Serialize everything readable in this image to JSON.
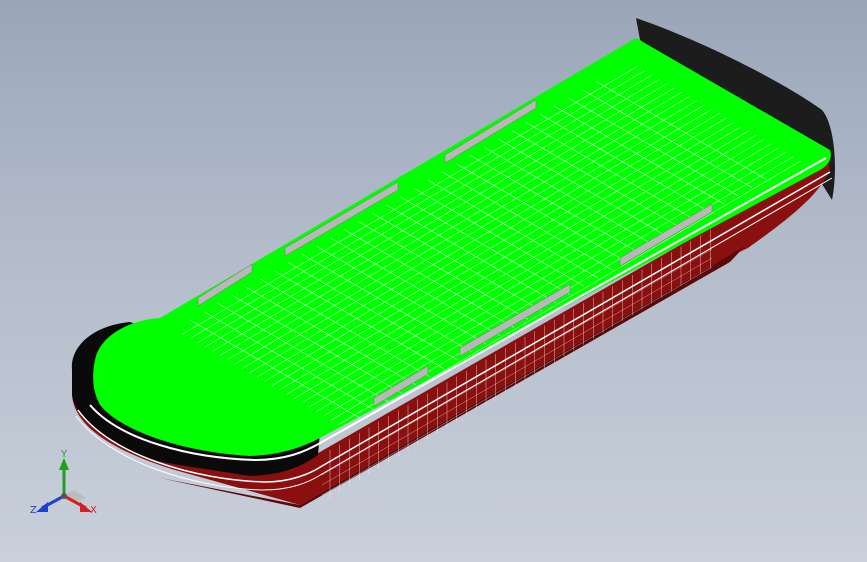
{
  "viewport": {
    "background_top": "#9aa6b8",
    "background_bottom": "#c9d0db"
  },
  "model": {
    "name": "barge",
    "deck_color": "#00ff00",
    "hull_color": "#8a1010",
    "hull_dark_color": "#5a0808",
    "bulwark_color": "#0a0a0a",
    "rail_color": "#ffffff",
    "hatch_color": "#b8b8b8",
    "shadow_color": "#1c1c1c"
  },
  "triad": {
    "x_label": "X",
    "y_label": "Y",
    "z_label": "Z",
    "x_color": "#d42020",
    "y_color": "#1fa01f",
    "z_color": "#2040d0"
  }
}
